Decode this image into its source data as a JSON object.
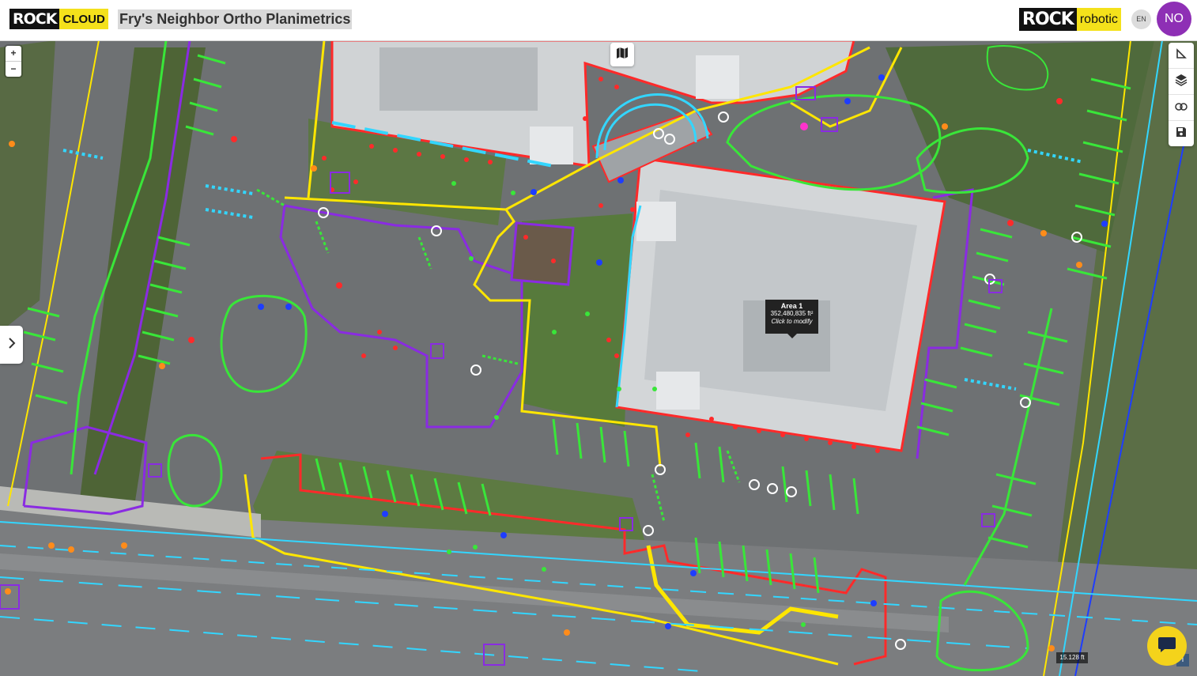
{
  "header": {
    "left_logo": {
      "rock": "ROCK",
      "suffix": "CLOUD"
    },
    "title": "Fry's Neighbor Ortho Planimetrics",
    "right_logo": {
      "rock": "ROCK",
      "suffix": "robotic"
    },
    "language": "EN",
    "user_initials": "NO"
  },
  "map": {
    "zoom_in": "+",
    "zoom_out": "−",
    "popup": {
      "title": "Area 1",
      "area": "352,480,835 ft²",
      "hint": "Click to modify"
    },
    "scale": "15.128 ft",
    "info": "i"
  },
  "tools": [
    {
      "name": "measure-icon"
    },
    {
      "name": "layers-icon"
    },
    {
      "name": "link-icon"
    },
    {
      "name": "save-icon"
    }
  ],
  "colors": {
    "brand_yellow": "#f4e11b",
    "avatar": "#8e2fb5",
    "feature_red": "#ff2a2a",
    "feature_yellow": "#ffe600",
    "feature_purple": "#8a2be2",
    "feature_green": "#39e639",
    "feature_cyan": "#33d6ff",
    "feature_blue": "#1e3dff"
  }
}
